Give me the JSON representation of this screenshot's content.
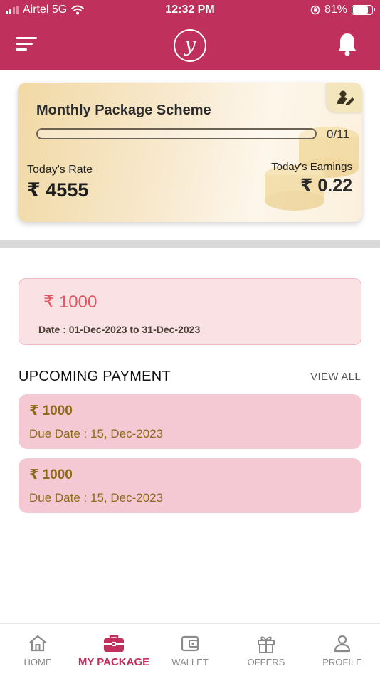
{
  "status_bar": {
    "carrier": "Airtel 5G",
    "time": "12:32 PM",
    "battery": "81%"
  },
  "header": {
    "logo_letter": "y",
    "menu_icon": "hamburger-menu-icon",
    "notification_icon": "bell-icon"
  },
  "package_card": {
    "title": "Monthly Package Scheme",
    "progress_text": "0/11",
    "progress_fraction": 0,
    "rate_label": "Today's Rate",
    "rate_value": "₹ 4555",
    "earnings_label": "Today's Earnings",
    "earnings_value": "₹ 0.22",
    "edit_icon": "user-edit-icon"
  },
  "current_plan": {
    "amount": "₹ 1000",
    "date_text": "Date : 01-Dec-2023  to  31-Dec-2023"
  },
  "upcoming": {
    "title": "UPCOMING PAYMENT",
    "view_all": "VIEW ALL",
    "items": [
      {
        "amount": "₹ 1000",
        "due": "Due Date  : 15, Dec-2023"
      },
      {
        "amount": "₹ 1000",
        "due": "Due Date  : 15, Dec-2023"
      }
    ]
  },
  "bottom_nav": {
    "active": "MY PACKAGE",
    "accent_color": "#c0305c",
    "items": [
      {
        "label": "HOME",
        "icon": "home-icon"
      },
      {
        "label": "MY PACKAGE",
        "icon": "briefcase-icon"
      },
      {
        "label": "WALLET",
        "icon": "wallet-icon"
      },
      {
        "label": "OFFERS",
        "icon": "gift-icon"
      },
      {
        "label": "PROFILE",
        "icon": "person-icon"
      }
    ]
  }
}
